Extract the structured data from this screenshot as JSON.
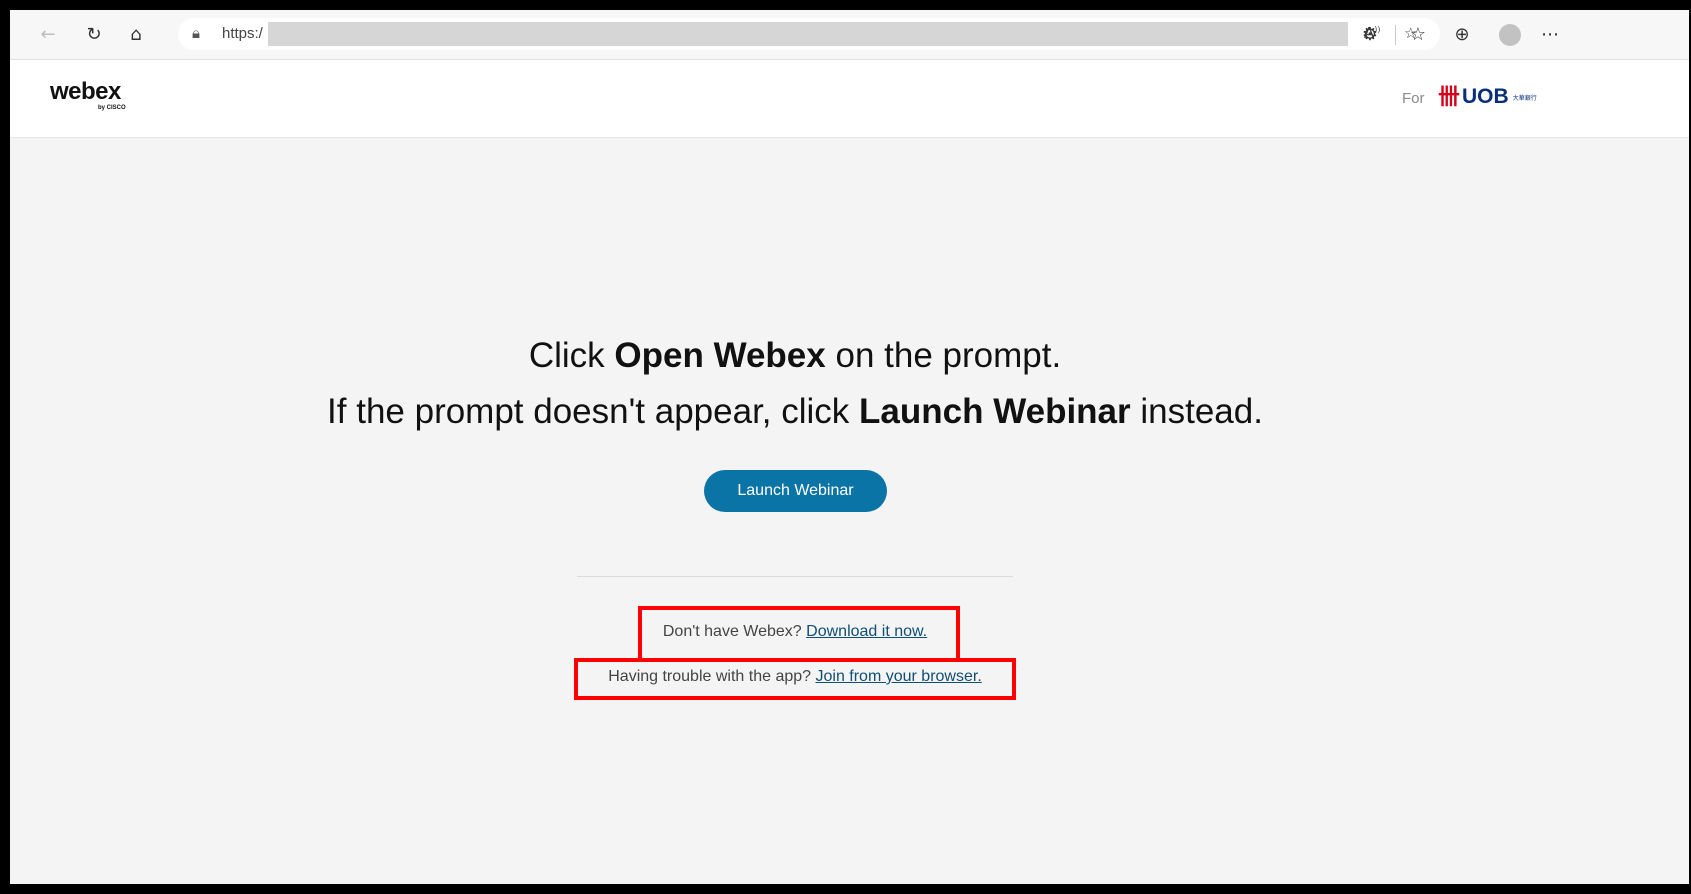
{
  "browser": {
    "url_prefix": "https:/",
    "read_aloud_icon": "read-aloud-icon",
    "favorite_icon": "favorite-add-icon"
  },
  "header": {
    "logo_text": "webex",
    "logo_sub": "by CISCO",
    "for_label": "For",
    "partner_logo_text": "UOB",
    "partner_logo_chinese": "大華銀行"
  },
  "main": {
    "line1_pre": "Click ",
    "line1_bold": "Open Webex",
    "line1_post": " on the prompt.",
    "line2_pre": "If the prompt doesn't appear, click ",
    "line2_bold": "Launch Webinar",
    "line2_post": " instead.",
    "launch_button": "Launch Webinar",
    "download_prompt": "Don't have Webex? ",
    "download_link": "Download it now.",
    "browser_prompt": "Having trouble with the app? ",
    "browser_link": "Join from your browser."
  },
  "colors": {
    "button": "#0a74a6",
    "link": "#0f4f74",
    "highlight": "#ff0000",
    "uob_red": "#d6001c",
    "uob_blue": "#0a2f7a"
  }
}
